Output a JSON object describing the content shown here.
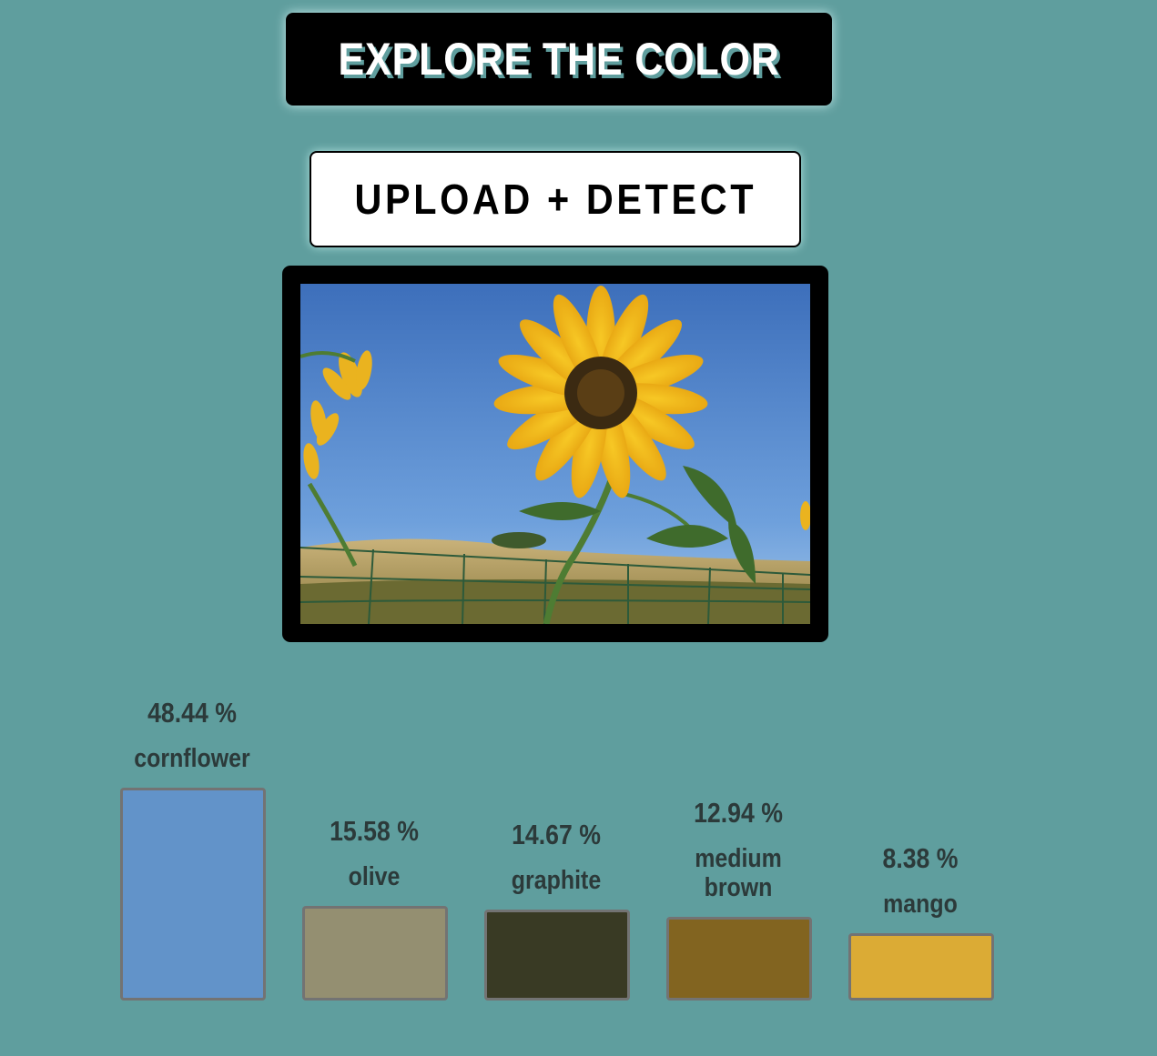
{
  "header": {
    "title": "EXPLORE THE COLOR"
  },
  "controls": {
    "upload_label": "UPLOAD + DETECT"
  },
  "image": {
    "subject": "sunflower-photo"
  },
  "colors": [
    {
      "percent": "48.44 %",
      "name": "cornflower",
      "name_line2": "",
      "hex": "#6293c9",
      "fraction": 0.4844
    },
    {
      "percent": "15.58 %",
      "name": "olive",
      "name_line2": "",
      "hex": "#948f71",
      "fraction": 0.1558
    },
    {
      "percent": "14.67 %",
      "name": "graphite",
      "name_line2": "",
      "hex": "#393a24",
      "fraction": 0.1467
    },
    {
      "percent": "12.94 %",
      "name": "medium",
      "name_line2": "brown",
      "hex": "#826420",
      "fraction": 0.1294
    },
    {
      "percent": "8.38 %",
      "name": "mango",
      "name_line2": "",
      "hex": "#dbab35",
      "fraction": 0.0838
    }
  ],
  "theme": {
    "background": "#5f9e9e",
    "text": "#2c3a3a",
    "swatch_border": "#737373"
  }
}
